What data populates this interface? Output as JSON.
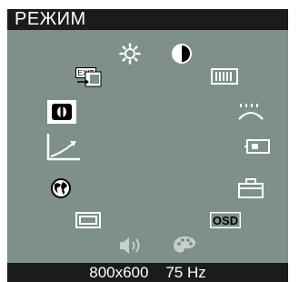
{
  "window": {
    "title": "РЕЖИМ"
  },
  "status": {
    "resolution": "800x600",
    "refresh": "75 Hz"
  },
  "status_text": "800x600    75 Hz",
  "icons": {
    "exit": "EXIT",
    "osd": "OSD"
  },
  "colors": {
    "panel": "#7e8f8c",
    "bar": "#1b1b1b",
    "icon": "#ffffff",
    "selected_bg": "#ffffff",
    "selected_fg": "#000000"
  },
  "menu": {
    "items": [
      {
        "name": "brightness",
        "icon": "sun-icon",
        "selected": false
      },
      {
        "name": "contrast",
        "icon": "half-circle-icon",
        "selected": false
      },
      {
        "name": "h-size",
        "icon": "vertical-bars-icon",
        "selected": false
      },
      {
        "name": "pincushion",
        "icon": "pincushion-icon",
        "selected": false
      },
      {
        "name": "h-position",
        "icon": "rectangle-shift-icon",
        "selected": false
      },
      {
        "name": "tilt",
        "icon": "briefcase-icon",
        "selected": false
      },
      {
        "name": "osd",
        "icon": "osd-icon",
        "selected": false
      },
      {
        "name": "color",
        "icon": "palette-icon",
        "selected": false
      },
      {
        "name": "volume",
        "icon": "speaker-icon",
        "selected": false
      },
      {
        "name": "size-frame",
        "icon": "frame-icon",
        "selected": false
      },
      {
        "name": "language",
        "icon": "globe-icon",
        "selected": false
      },
      {
        "name": "gamma",
        "icon": "curve-icon",
        "selected": false
      },
      {
        "name": "mode",
        "icon": "mode-icon",
        "selected": true
      },
      {
        "name": "exit",
        "icon": "exit-icon",
        "selected": false
      }
    ]
  }
}
